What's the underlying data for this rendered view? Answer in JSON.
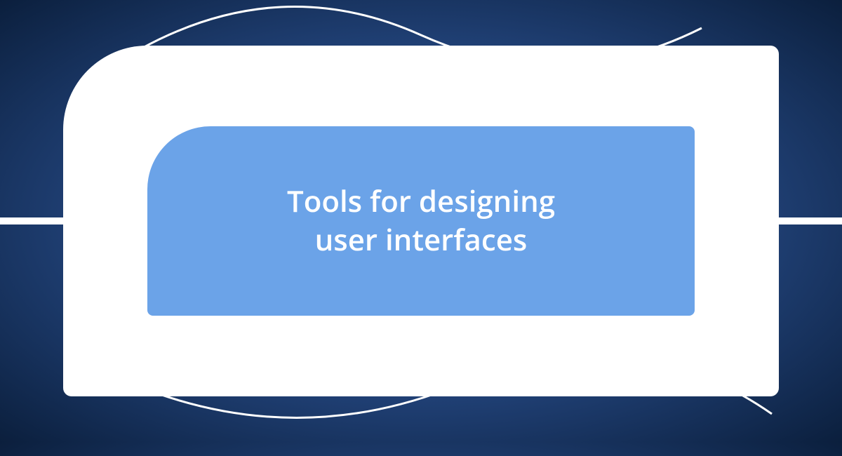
{
  "title": "Tools for designing\nuser interfaces",
  "colors": {
    "inner_bg": "#6ba3e8",
    "outer_bg": "#ffffff",
    "text": "#ffffff"
  }
}
